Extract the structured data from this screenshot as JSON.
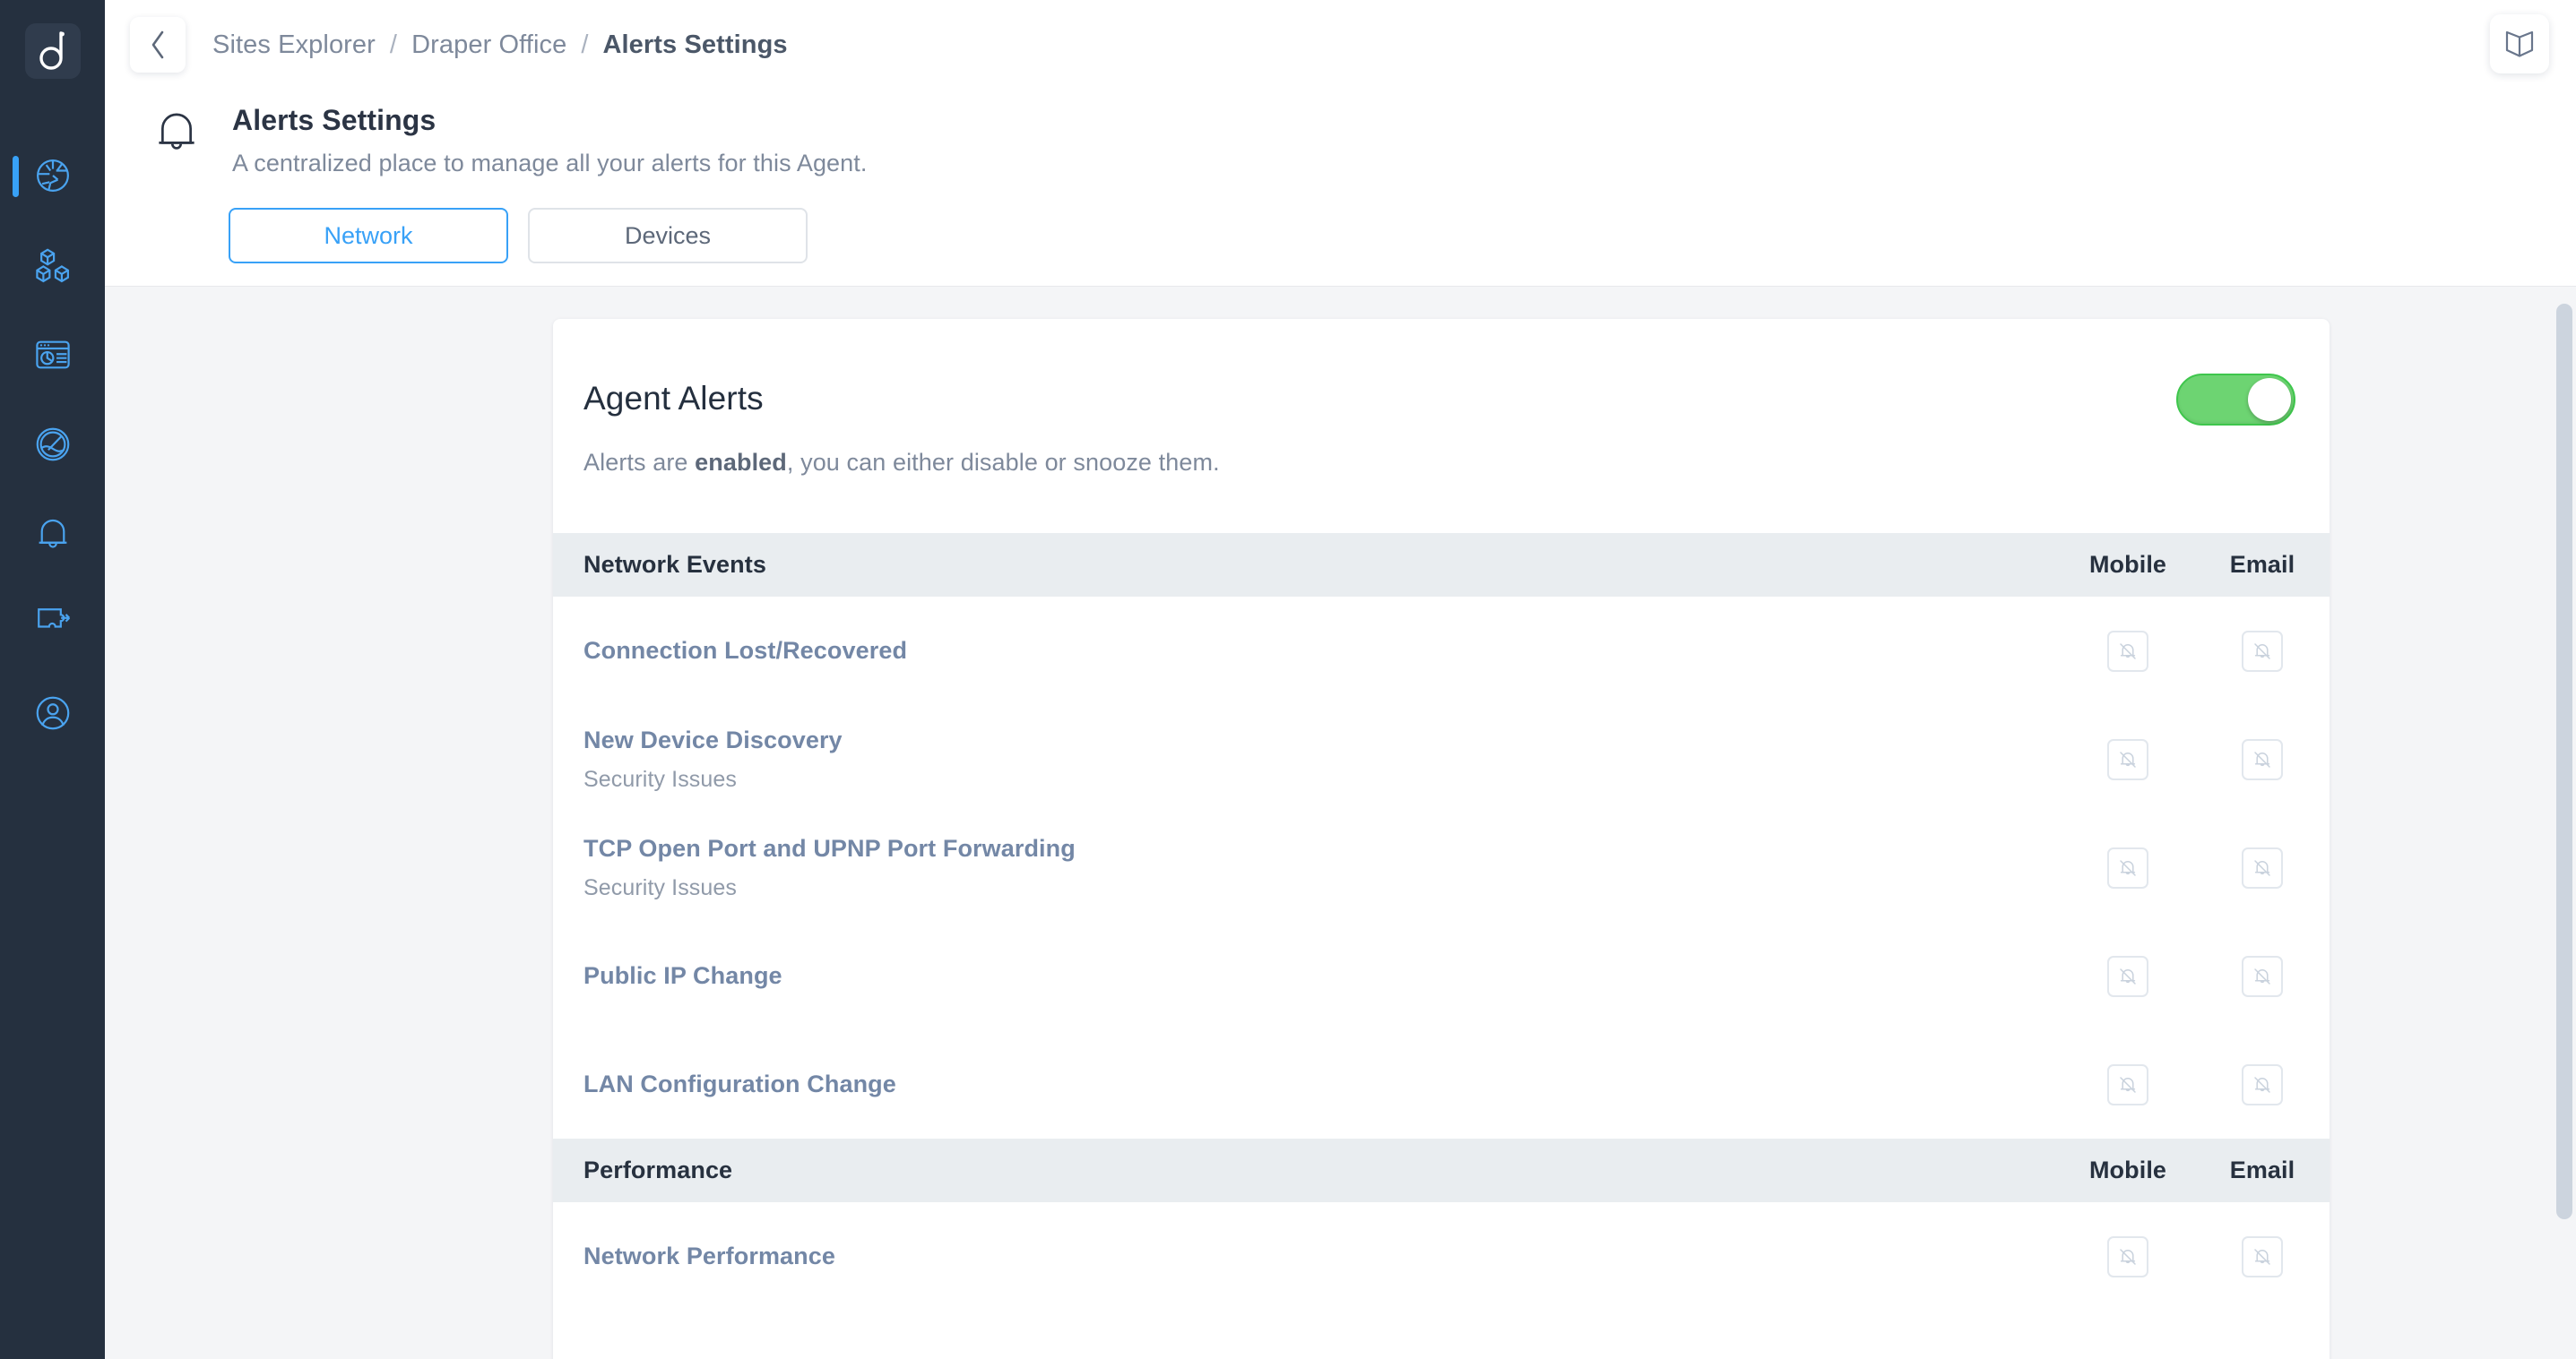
{
  "brand": {
    "logo_glyph": "d",
    "accent": "#38a1f7",
    "rail_bg": "#25303f"
  },
  "sidebar": {
    "items": [
      {
        "name": "globe-icon",
        "label": "Network",
        "active": true
      },
      {
        "name": "cubes-icon",
        "label": "Inventory",
        "active": false
      },
      {
        "name": "dashboard-icon",
        "label": "Reports",
        "active": false
      },
      {
        "name": "gauge-icon",
        "label": "Insights",
        "active": false
      },
      {
        "name": "bell-icon",
        "label": "Alerts",
        "active": false
      },
      {
        "name": "integration-icon",
        "label": "Integrations",
        "active": false
      },
      {
        "name": "user-icon",
        "label": "Account",
        "active": false
      }
    ]
  },
  "topbar": {
    "back_label": "‹",
    "breadcrumbs": [
      {
        "label": "Sites Explorer",
        "current": false
      },
      {
        "label": "Draper Office",
        "current": false
      },
      {
        "label": "Alerts Settings",
        "current": true
      }
    ],
    "separator": "/",
    "help_icon": "book-icon"
  },
  "page": {
    "icon": "bell-icon",
    "title": "Alerts Settings",
    "subtitle": "A centralized place to manage all your alerts for this Agent."
  },
  "tabs": [
    {
      "label": "Network",
      "active": true
    },
    {
      "label": "Devices",
      "active": false
    }
  ],
  "card": {
    "title": "Agent Alerts",
    "desc_prefix": "Alerts are ",
    "desc_state": "enabled",
    "desc_suffix": ", you can either disable or snooze them.",
    "toggle": {
      "name": "agent-alerts-toggle",
      "state": "on",
      "color": "#6dd472"
    }
  },
  "columns": {
    "mobile": "Mobile",
    "email": "Email"
  },
  "groups": [
    {
      "title": "Network Events",
      "rows": [
        {
          "name": "Connection Lost/Recovered",
          "sub": "",
          "mobile": "muted",
          "email": "muted"
        },
        {
          "name": "New Device Discovery",
          "sub": "Security Issues",
          "mobile": "muted",
          "email": "muted"
        },
        {
          "name": "TCP Open Port and UPNP Port Forwarding",
          "sub": "Security Issues",
          "mobile": "muted",
          "email": "muted"
        },
        {
          "name": "Public IP Change",
          "sub": "",
          "mobile": "muted",
          "email": "muted"
        },
        {
          "name": "LAN Configuration Change",
          "sub": "",
          "mobile": "muted",
          "email": "muted"
        }
      ]
    },
    {
      "title": "Performance",
      "rows": [
        {
          "name": "Network Performance",
          "sub": "",
          "mobile": "muted",
          "email": "muted"
        }
      ]
    }
  ]
}
